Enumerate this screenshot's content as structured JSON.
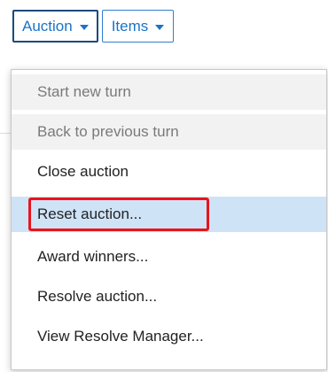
{
  "menubar": {
    "auction_label": "Auction",
    "items_label": "Items"
  },
  "dropdown": {
    "items": [
      {
        "label": "Start new turn",
        "state": "disabled"
      },
      {
        "label": "Back to previous turn",
        "state": "disabled"
      },
      {
        "label": "Close auction",
        "state": "normal"
      },
      {
        "label": "Reset auction...",
        "state": "selected"
      },
      {
        "label": "Award winners...",
        "state": "normal"
      },
      {
        "label": "Resolve auction...",
        "state": "normal"
      },
      {
        "label": "View Resolve Manager...",
        "state": "normal"
      }
    ]
  },
  "colors": {
    "link_blue": "#1a73c8",
    "selected_bg": "#cfe3f7",
    "highlight_red": "#e8141c"
  }
}
